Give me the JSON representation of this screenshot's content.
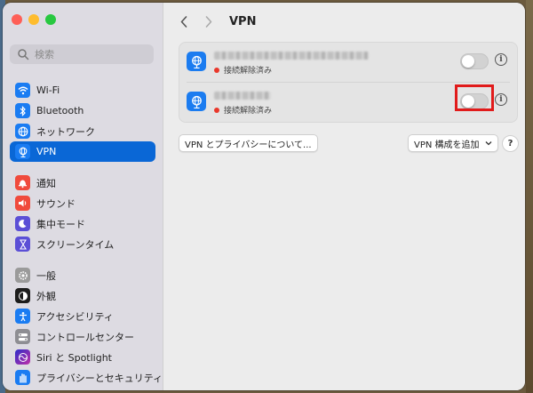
{
  "window": {
    "title": "VPN"
  },
  "search": {
    "placeholder": "検索"
  },
  "sidebar": {
    "items": [
      {
        "label": "Wi-Fi",
        "icon": "wifi-icon",
        "color": "#1a7cf2"
      },
      {
        "label": "Bluetooth",
        "icon": "bluetooth-icon",
        "color": "#1a7cf2"
      },
      {
        "label": "ネットワーク",
        "icon": "globe-icon",
        "color": "#1a7cf2"
      },
      {
        "label": "VPN",
        "icon": "vpn-globe-icon",
        "color": "#1a7cf2",
        "active": true
      },
      {
        "label": "通知",
        "icon": "bell-icon",
        "color": "#f04a3c"
      },
      {
        "label": "サウンド",
        "icon": "speaker-icon",
        "color": "#f04a3c"
      },
      {
        "label": "集中モード",
        "icon": "moon-icon",
        "color": "#5b4fd6"
      },
      {
        "label": "スクリーンタイム",
        "icon": "hourglass-icon",
        "color": "#5b4fd6"
      },
      {
        "label": "一般",
        "icon": "gear-icon",
        "color": "#9a9a9a"
      },
      {
        "label": "外観",
        "icon": "appearance-icon",
        "color": "#1c1c1c"
      },
      {
        "label": "アクセシビリティ",
        "icon": "accessibility-icon",
        "color": "#1a7cf2"
      },
      {
        "label": "コントロールセンター",
        "icon": "control-center-icon",
        "color": "#8e8e93"
      },
      {
        "label": "Siri と Spotlight",
        "icon": "siri-icon",
        "color": "#5b2ec9"
      },
      {
        "label": "プライバシーとセキュリティ",
        "icon": "hand-icon",
        "color": "#1a7cf2"
      }
    ]
  },
  "vpn": {
    "connections": [
      {
        "status": "接続解除済み",
        "enabled": false
      },
      {
        "status": "接続解除済み",
        "enabled": false
      }
    ],
    "privacy_button": "VPN とプライバシーについて...",
    "add_button": "VPN 構成を追加",
    "help_label": "?",
    "info_label": "i"
  },
  "colors": {
    "accent": "#0a67d6",
    "status_disconnected": "#e9382b",
    "highlight": "#e11b1b"
  }
}
